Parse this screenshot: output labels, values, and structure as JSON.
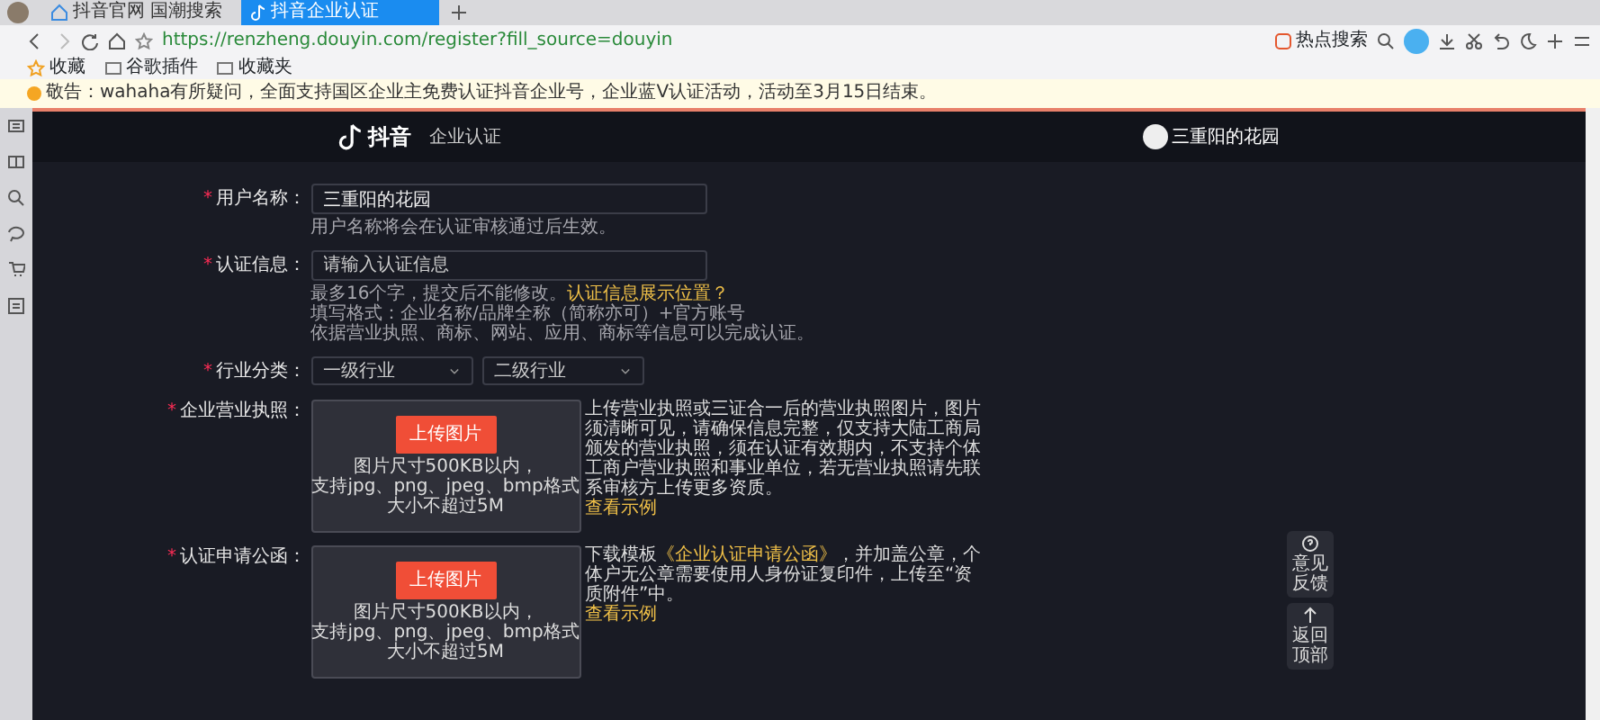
{
  "browser": {
    "tabs": [
      {
        "title": "抖音官网 国潮搜索",
        "selected": false
      },
      {
        "title": "抖音企业认证",
        "selected": true
      }
    ],
    "address": {
      "url": "https://renzheng.douyin.com/register?fill_source=douyin"
    },
    "bookmarks": [
      "收藏",
      "谷歌插件",
      "收藏夹"
    ],
    "search_label": "热点搜索",
    "notice": "敬告：wahaha有所疑问，全面支持国区企业主免费认证抖音企业号，企业蓝V认证活动，活动至3月15日结束。"
  },
  "page": {
    "brand": "抖音",
    "nav_title": "企业认证",
    "user_name": "三重阳的花园"
  },
  "form": {
    "required_mark": "*",
    "fields": [
      {
        "kind": "input",
        "label": "用户名称：",
        "value": "三重阳的花园",
        "help": [
          [
            {
              "text": "用户名称将会在认证审核通过后生效。",
              "kind": "text"
            }
          ]
        ]
      },
      {
        "kind": "input",
        "label": "认证信息：",
        "placeholder": "请输入认证信息",
        "help": [
          [
            {
              "text": "最多16个字，提交后不能修改。",
              "kind": "text"
            },
            {
              "text": "认证信息展示位置？",
              "kind": "link"
            }
          ],
          [
            {
              "text": "填写格式：企业名称/品牌全称（简称亦可）+官方账号",
              "kind": "text"
            }
          ],
          [
            {
              "text": "依据营业执照、商标、网站、应用、商标等信息可以完成认证。",
              "kind": "text"
            }
          ]
        ]
      },
      {
        "kind": "select",
        "label": "行业分类：",
        "selects": [
          "一级行业",
          "二级行业"
        ]
      },
      {
        "kind": "upload",
        "label": "企业营业执照：",
        "button": "上传图片",
        "hint": [
          "图片尺寸500KB以内，",
          "支持jpg、png、jpeg、bmp格式",
          "大小不超过5M"
        ],
        "description": [
          {
            "text": "上传营业执照或三证合一后的营业执照图片，图片须清晰可见，请确保信息完整，仅支持大陆工商局颁发的营业执照，须在认证有效期内，不支持个体工商户营业执照和事业单位，若无营业执照请先联系审核方上传更多资质。",
            "kind": "text"
          }
        ],
        "example": "查看示例"
      },
      {
        "kind": "upload",
        "label": "认证申请公函：",
        "button": "上传图片",
        "hint": [
          "图片尺寸500KB以内，",
          "支持jpg、png、jpeg、bmp格式",
          "大小不超过5M"
        ],
        "description": [
          {
            "text": "下载模板",
            "kind": "text"
          },
          {
            "text": "《企业认证申请公函》",
            "kind": "link"
          },
          {
            "text": "，并加盖公章，个体户无公章需要使用人身份证复印件，上传至“资质附件”中。",
            "kind": "text"
          }
        ],
        "example": "查看示例"
      }
    ]
  },
  "float_buttons": [
    {
      "label": "意见反馈"
    },
    {
      "label": "返回顶部"
    }
  ]
}
